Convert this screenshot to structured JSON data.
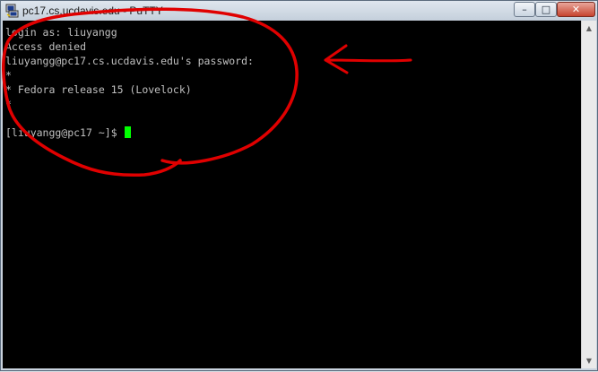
{
  "window": {
    "title": "pc17.cs.ucdavis.edu - PuTTY",
    "minimize_glyph": "–",
    "maximize_glyph": "□",
    "close_glyph": "✕",
    "app_icon": "putty-icon"
  },
  "terminal": {
    "background": "#000000",
    "text_color": "#c0c0c0",
    "cursor_color": "#00ff00",
    "lines": [
      "login as: liuyangg",
      "Access denied",
      "liuyangg@pc17.cs.ucdavis.edu's password:",
      "*",
      "* Fedora release 15 (Lovelock)",
      "*",
      "",
      "[liuyangg@pc17 ~]$"
    ]
  },
  "scrollbar": {
    "up_icon": "scroll-up-arrow-icon",
    "down_icon": "scroll-down-arrow-icon"
  },
  "annotation": {
    "color": "#e00000",
    "shapes": [
      "freehand-circle",
      "arrow"
    ]
  }
}
